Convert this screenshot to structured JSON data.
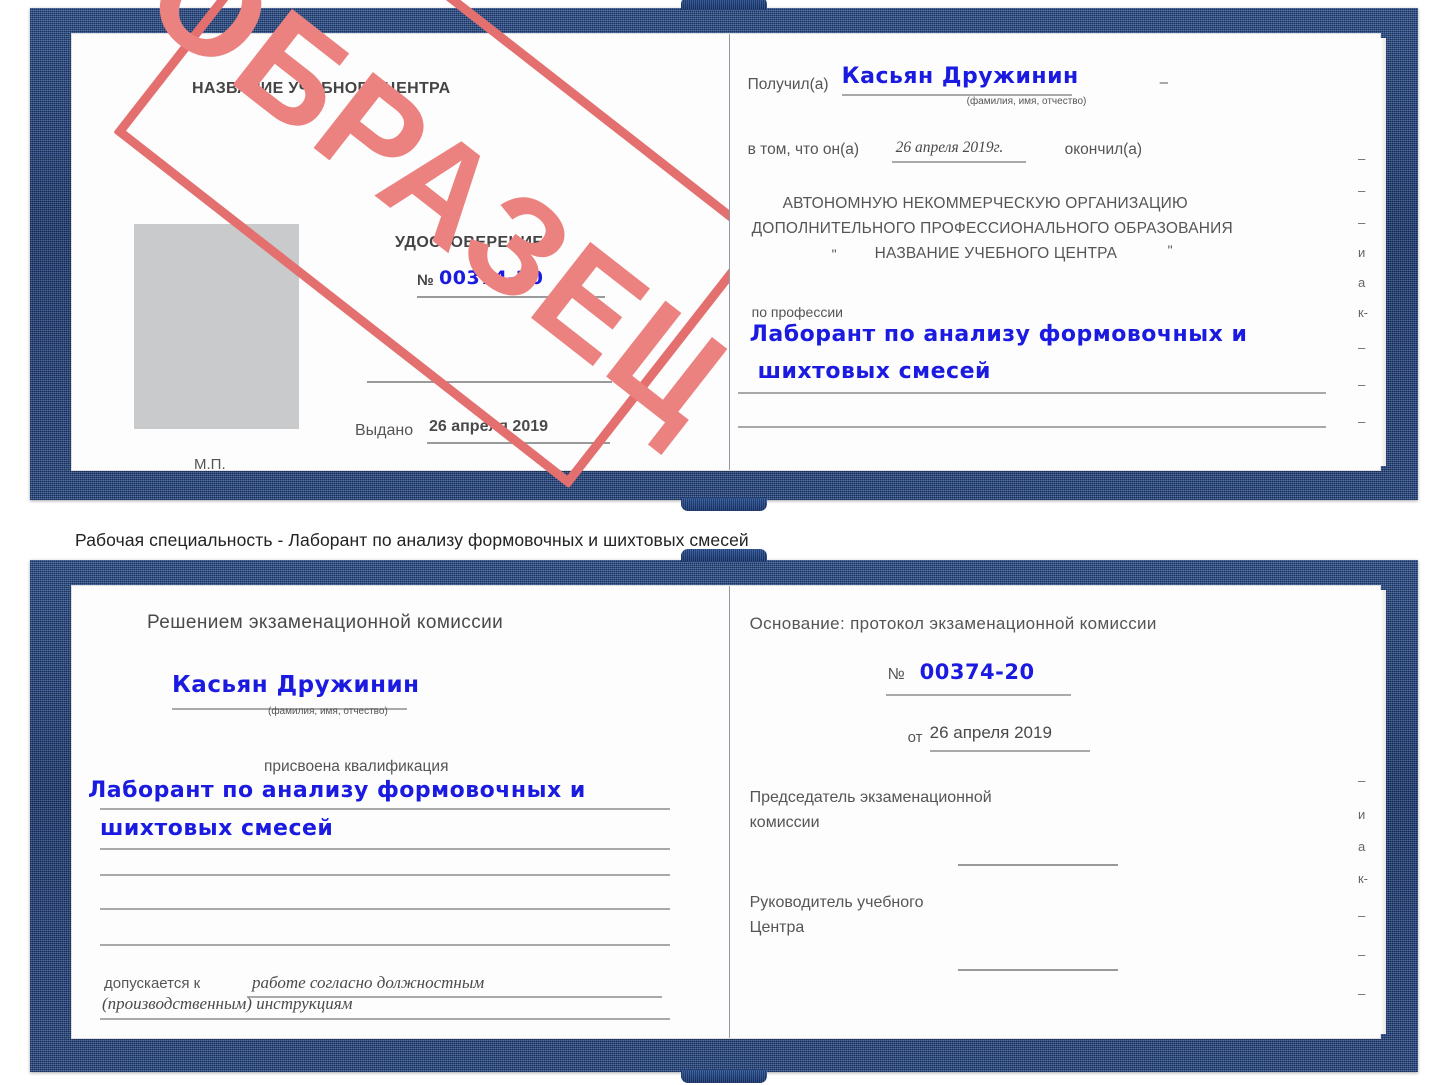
{
  "document": {
    "type": "Удостоверение (свидетельство) о профессиональном обучении — образец",
    "stamp_label": "ОБРАЗЕЦ",
    "stamp_color": "#e3706f",
    "cover_color": "#254a8c",
    "handwriting_color": "#1a1ae0",
    "photo_placeholder_color": "#c8cacb"
  },
  "caption": {
    "text": "Рабочая специальность - Лаборант по анализу формовочных и шихтовых смесей"
  },
  "top_certificate": {
    "left_page": {
      "center_name": "НАЗВАНИЕ УЧЕБНОГО ЦЕНТРА",
      "title": "УДОСТОВЕРЕНИЕ",
      "number_symbol": "№",
      "number_value": "00374-20",
      "issued_label": "Выдано",
      "issued_value": "26 апреля 2019",
      "seal_label": "М.П."
    },
    "right_page": {
      "received_label": "Получил(а)",
      "received_value": "Касьян Дружинин",
      "received_hint": "(фамилия, имя, отчество)",
      "dash_right": "–",
      "in_that_label": "в том, что он(а)",
      "completion_date": "26 апреля 2019г.",
      "finished_label": "окончил(а)",
      "org_line1": "АВТОНОМНУЮ НЕКОММЕРЧЕСКУЮ ОРГАНИЗАЦИЮ",
      "org_line2": "ДОПОЛНИТЕЛЬНОГО ПРОФЕССИОНАЛЬНОГО ОБРАЗОВАНИЯ",
      "org_quote_open": "\"",
      "org_name": "НАЗВАНИЕ УЧЕБНОГО ЦЕНТРА",
      "org_quote_close": "\"",
      "profession_label": "по профессии",
      "profession_line1": "Лаборант по анализу формовочных и",
      "profession_line2": "шихтовых смесей",
      "edge_glyphs": [
        "–",
        "–",
        "–",
        "и",
        "а",
        "к-",
        "–",
        "–",
        "–"
      ]
    }
  },
  "bottom_certificate": {
    "left_page": {
      "heading": "Решением экзаменационной комиссии",
      "name_value": "Касьян Дружинин",
      "name_hint": "(фамилия, имя, отчество)",
      "qualification_label": "присвоена квалификация",
      "qualification_line1": "Лаборант по анализу формовочных и",
      "qualification_line2": "шихтовых смесей",
      "admitted_label": "допускается к",
      "admitted_line1": "работе согласно должностным",
      "admitted_line2": "(производственным) инструкциям"
    },
    "right_page": {
      "basis_label": "Основание: протокол экзаменационной комиссии",
      "number_symbol": "№",
      "number_value": "00374-20",
      "date_label": "от",
      "date_value": "26 апреля 2019",
      "chairman_line1": "Председатель экзаменационной",
      "chairman_line2": "комиссии",
      "head_line1": "Руководитель учебного",
      "head_line2": "Центра",
      "edge_glyphs": [
        "–",
        "и",
        "а",
        "к-",
        "–",
        "–",
        "–"
      ]
    }
  }
}
